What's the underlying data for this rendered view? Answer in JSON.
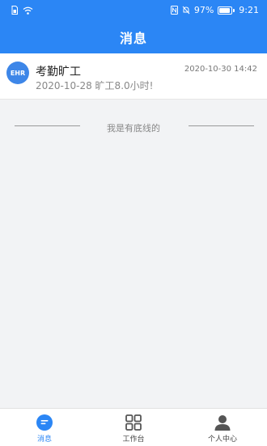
{
  "status_bar": {
    "battery_text": "97%",
    "time": "9:21"
  },
  "header": {
    "title": "消息"
  },
  "message": {
    "avatar_text": "EHR",
    "title": "考勤旷工",
    "time": "2020-10-30 14:42",
    "subtitle": "2020-10-28 旷工8.0小时!"
  },
  "bottom_text": "我是有底线的",
  "tabs": [
    {
      "label": "消息",
      "icon": "message-icon",
      "active": true
    },
    {
      "label": "工作台",
      "icon": "grid-icon",
      "active": false
    },
    {
      "label": "个人中心",
      "icon": "person-icon",
      "active": false
    }
  ],
  "colors": {
    "accent": "#2b86f5",
    "background": "#f2f3f5"
  }
}
